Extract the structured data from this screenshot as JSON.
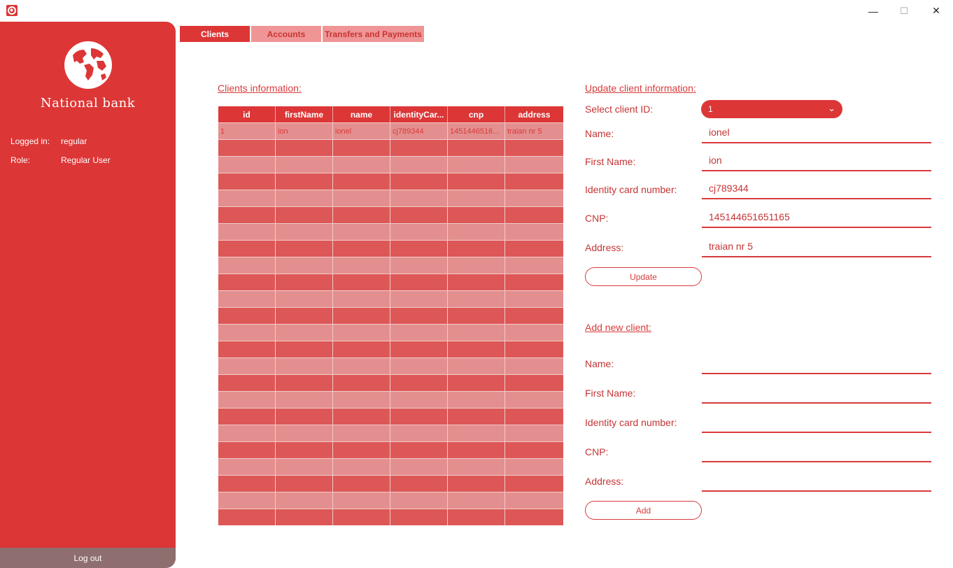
{
  "window": {
    "minimize": "—",
    "maximize": "☐",
    "close": "✕"
  },
  "sidebar": {
    "bank_name": "National bank",
    "logged_in_label": "Logged in:",
    "logged_in_value": "regular",
    "role_label": "Role:",
    "role_value": "Regular User",
    "logout": "Log out"
  },
  "tabs": [
    {
      "label": "Clients",
      "active": true
    },
    {
      "label": "Accounts",
      "active": false
    },
    {
      "label": "Transfers and Payments",
      "active": false
    }
  ],
  "clients_table": {
    "title": "Clients information:",
    "columns": [
      "id",
      "firstName",
      "name",
      "identityCar...",
      "cnp",
      "address"
    ],
    "rows": [
      [
        "1",
        "ion",
        "ionel",
        "cj789344",
        "1451446516...",
        "traian nr 5"
      ]
    ]
  },
  "update_form": {
    "title": "Update client information:",
    "select_label": "Select client ID:",
    "select_value": "1",
    "name_label": "Name:",
    "name_value": "ionel",
    "first_name_label": "First Name:",
    "first_name_value": "ion",
    "id_card_label": "Identity card number:",
    "id_card_value": "cj789344",
    "cnp_label": "CNP:",
    "cnp_value": "145144651651165",
    "address_label": "Address:",
    "address_value": "traian nr 5",
    "button": "Update"
  },
  "add_form": {
    "title": "Add new client:",
    "name_label": "Name:",
    "first_name_label": "First Name:",
    "id_card_label": "Identity card number:",
    "cnp_label": "CNP:",
    "address_label": "Address:",
    "button": "Add"
  },
  "colors": {
    "primary": "#dc3636",
    "light": "#ef9595",
    "row_odd": "#e48f8f",
    "row_even": "#dd5757",
    "logout_bg": "#8e6e6e"
  },
  "icons": {
    "app": "bank-app-icon",
    "globe": "globe-icon",
    "dropdown": "chevron-down-icon"
  }
}
